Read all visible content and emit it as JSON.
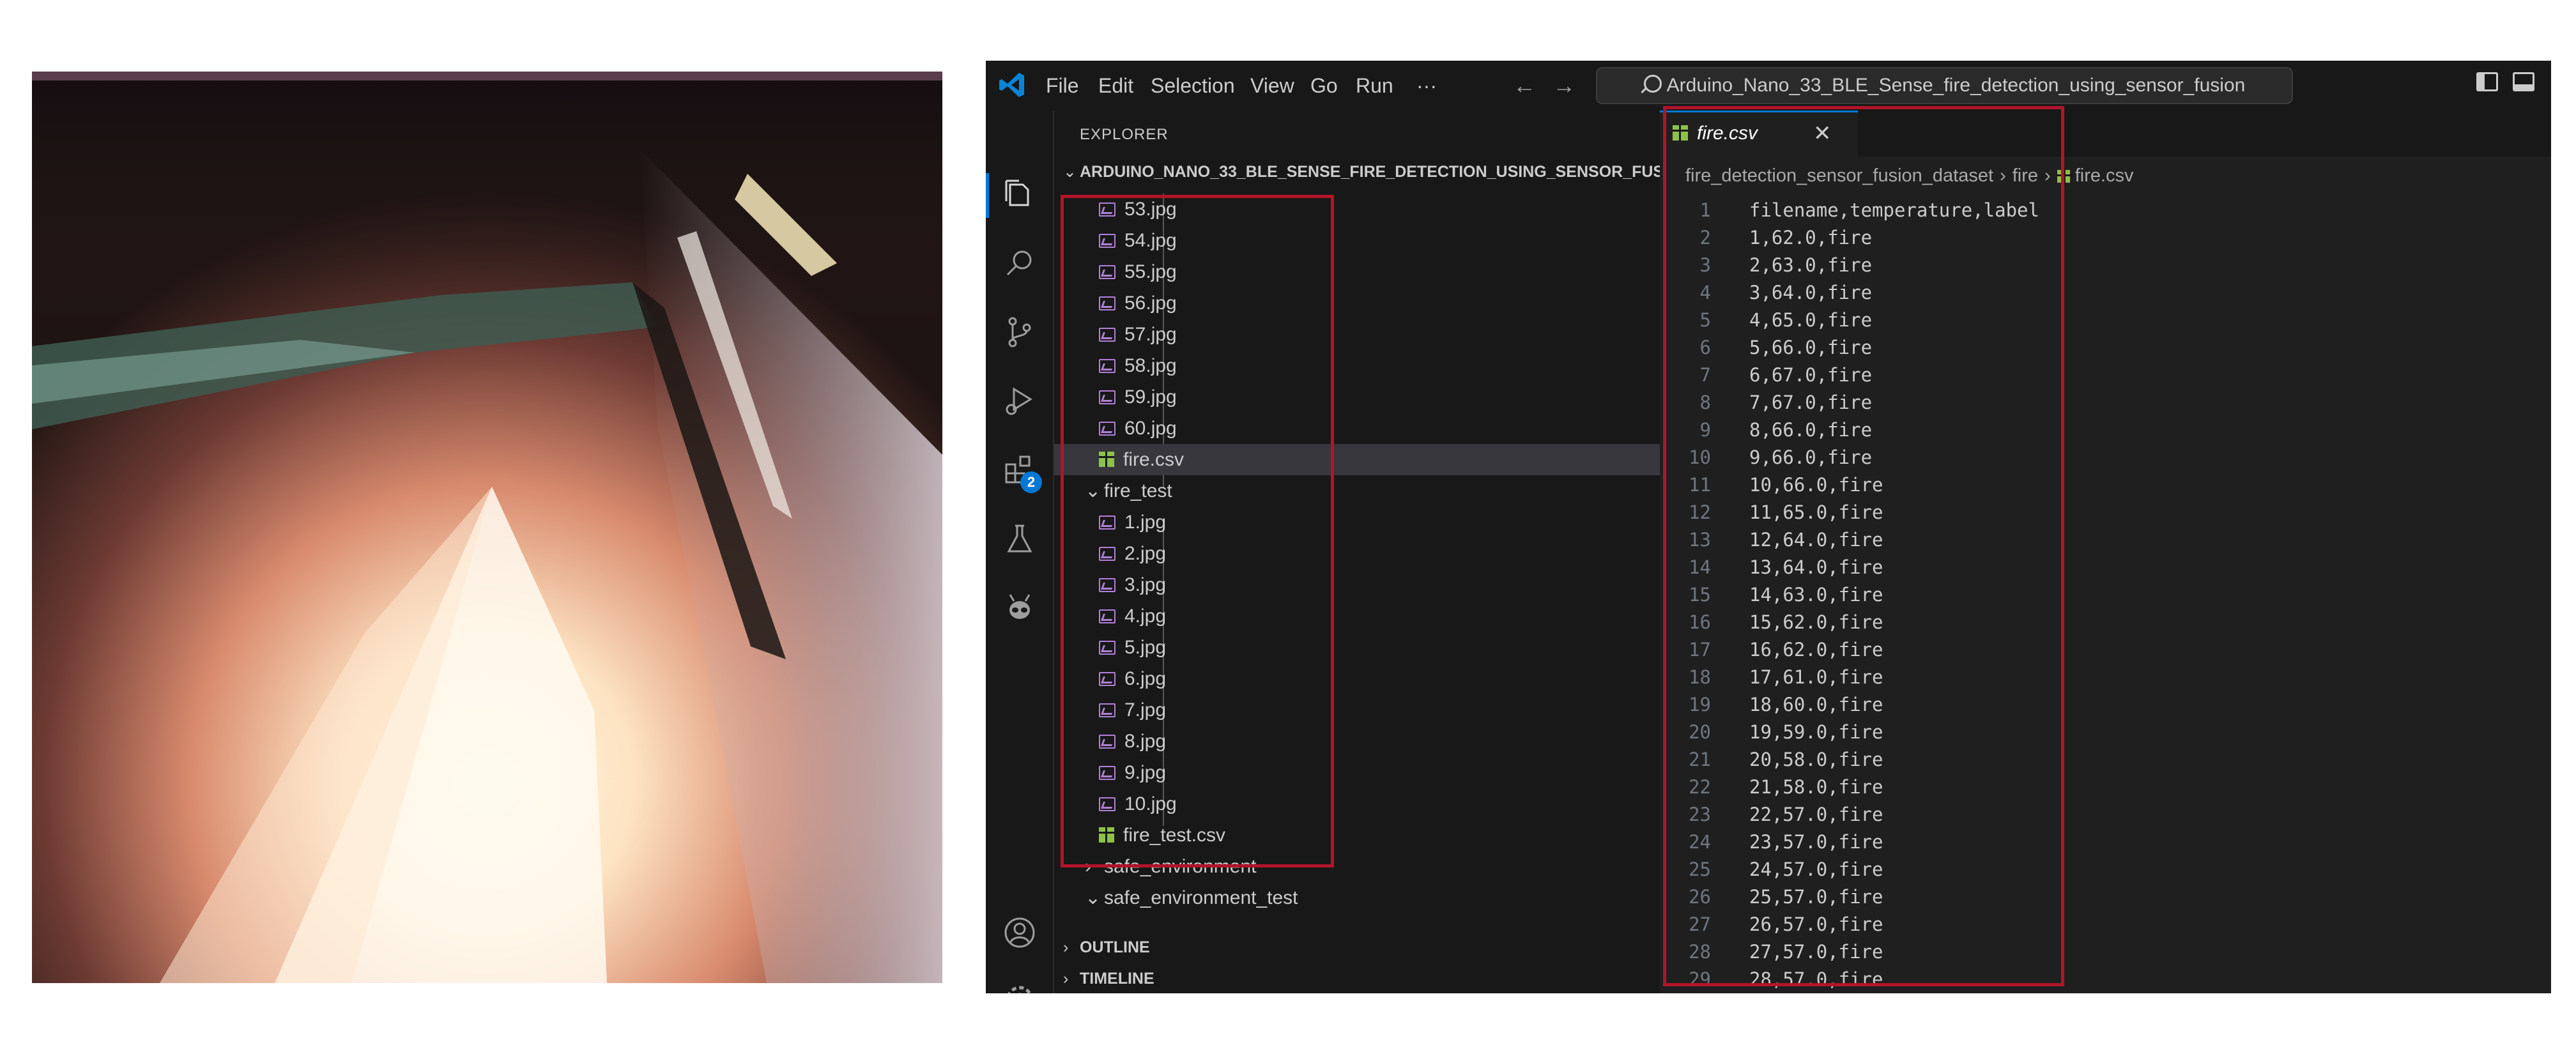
{
  "titlebar": {
    "menu": [
      "File",
      "Edit",
      "Selection",
      "View",
      "Go",
      "Run",
      "···"
    ],
    "back_arrow": "←",
    "forward_arrow": "→",
    "search_text": "Arduino_Nano_33_BLE_Sense_fire_detection_using_sensor_fusion"
  },
  "activity_bar": {
    "icons": [
      "explorer-icon",
      "search-icon",
      "source-control-icon",
      "run-debug-icon",
      "extensions-icon",
      "testing-icon",
      "alien-icon",
      "account-icon",
      "gear-icon"
    ],
    "extensions_badge": "2",
    "accent": "#0078d4"
  },
  "sidebar": {
    "header": "EXPLORER",
    "more_actions": "···",
    "project_title": "ARDUINO_NANO_33_BLE_SENSE_FIRE_DETECTION_USING_SENSOR_FUSION",
    "items": [
      {
        "label": "53.jpg",
        "kind": "image",
        "level": 2
      },
      {
        "label": "54.jpg",
        "kind": "image",
        "level": 2
      },
      {
        "label": "55.jpg",
        "kind": "image",
        "level": 2
      },
      {
        "label": "56.jpg",
        "kind": "image",
        "level": 2
      },
      {
        "label": "57.jpg",
        "kind": "image",
        "level": 2
      },
      {
        "label": "58.jpg",
        "kind": "image",
        "level": 2
      },
      {
        "label": "59.jpg",
        "kind": "image",
        "level": 2
      },
      {
        "label": "60.jpg",
        "kind": "image",
        "level": 2
      },
      {
        "label": "fire.csv",
        "kind": "csv",
        "level": 2,
        "selected": true
      },
      {
        "label": "fire_test",
        "kind": "folder-open",
        "level": 1
      },
      {
        "label": "1.jpg",
        "kind": "image",
        "level": 2
      },
      {
        "label": "2.jpg",
        "kind": "image",
        "level": 2
      },
      {
        "label": "3.jpg",
        "kind": "image",
        "level": 2
      },
      {
        "label": "4.jpg",
        "kind": "image",
        "level": 2
      },
      {
        "label": "5.jpg",
        "kind": "image",
        "level": 2
      },
      {
        "label": "6.jpg",
        "kind": "image",
        "level": 2
      },
      {
        "label": "7.jpg",
        "kind": "image",
        "level": 2
      },
      {
        "label": "8.jpg",
        "kind": "image",
        "level": 2
      },
      {
        "label": "9.jpg",
        "kind": "image",
        "level": 2
      },
      {
        "label": "10.jpg",
        "kind": "image",
        "level": 2
      },
      {
        "label": "fire_test.csv",
        "kind": "csv",
        "level": 2
      },
      {
        "label": "safe_environment",
        "kind": "folder-closed",
        "level": 1
      },
      {
        "label": "safe_environment_test",
        "kind": "folder-open",
        "level": 1
      }
    ],
    "outline": "OUTLINE",
    "timeline": "TIMELINE"
  },
  "editor": {
    "tab_label": "fire.csv",
    "tab_close": "✕",
    "breadcrumb": [
      "fire_detection_sensor_fusion_dataset",
      "fire",
      "fire.csv"
    ],
    "lines": [
      "filename,temperature,label",
      "1,62.0,fire",
      "2,63.0,fire",
      "3,64.0,fire",
      "4,65.0,fire",
      "5,66.0,fire",
      "6,67.0,fire",
      "7,67.0,fire",
      "8,66.0,fire",
      "9,66.0,fire",
      "10,66.0,fire",
      "11,65.0,fire",
      "12,64.0,fire",
      "13,64.0,fire",
      "14,63.0,fire",
      "15,62.0,fire",
      "16,62.0,fire",
      "17,61.0,fire",
      "18,60.0,fire",
      "19,59.0,fire",
      "20,58.0,fire",
      "21,58.0,fire",
      "22,57.0,fire",
      "23,57.0,fire",
      "24,57.0,fire",
      "25,57.0,fire",
      "26,57.0,fire",
      "27,57.0,fire",
      "28,57.0,fire"
    ]
  },
  "highlight_color": "#b2142a"
}
